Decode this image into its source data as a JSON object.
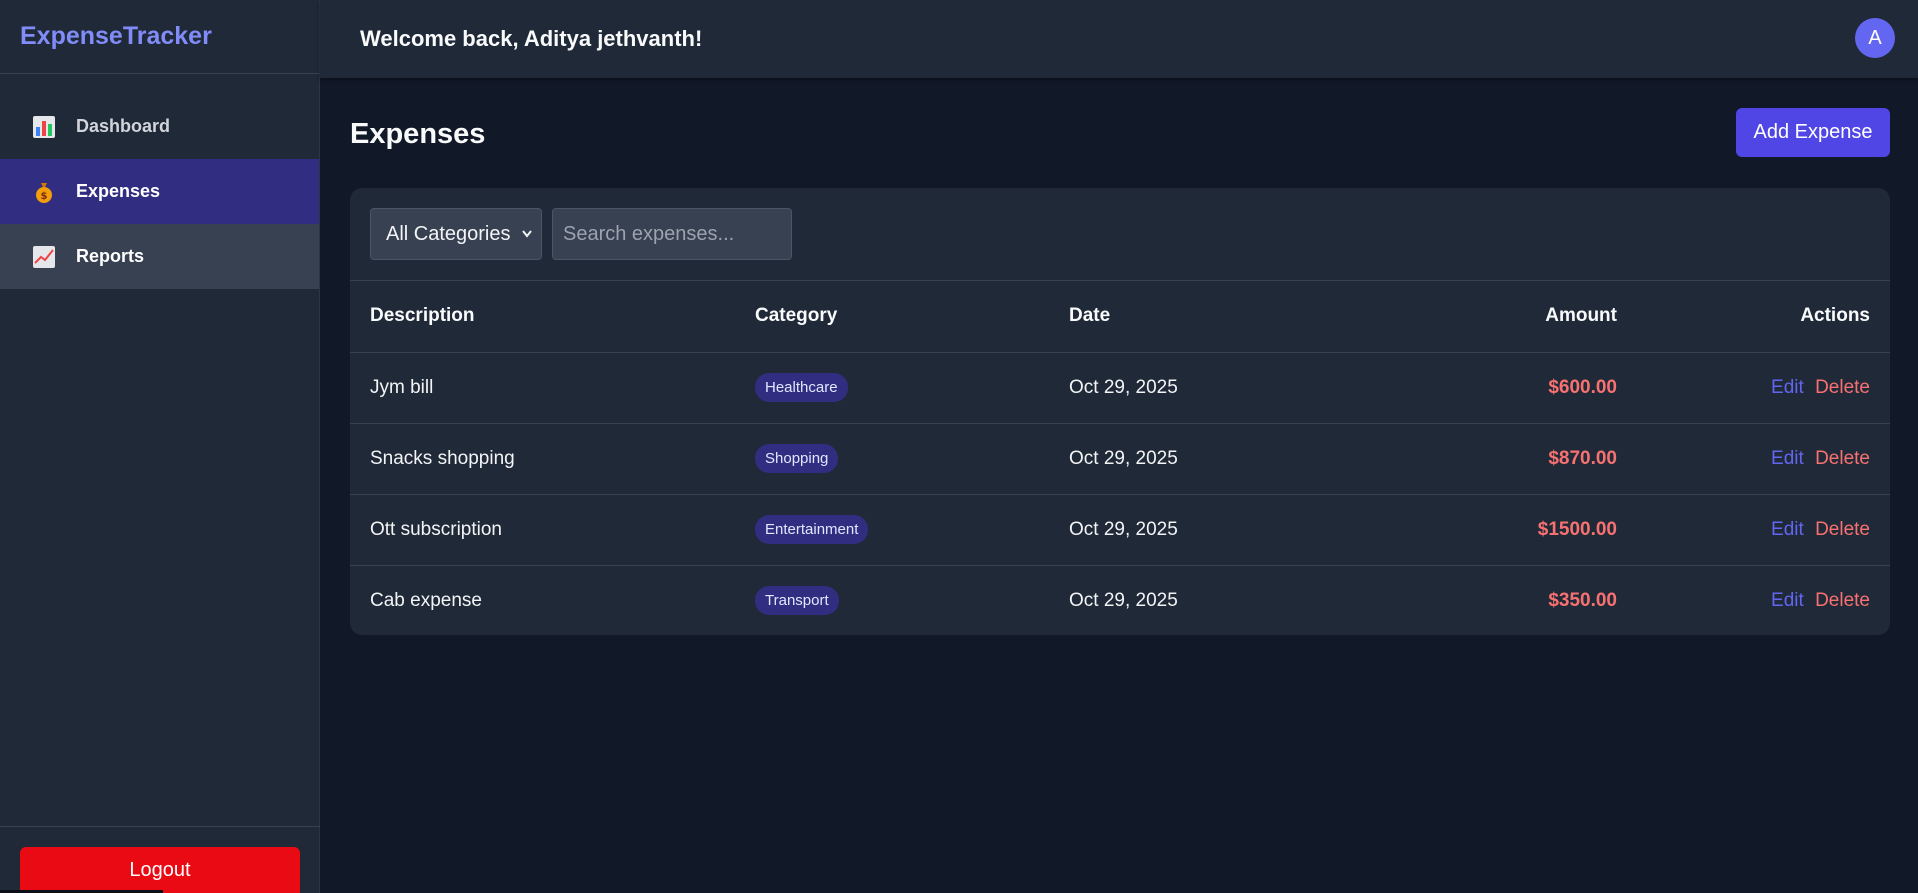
{
  "app": {
    "brand": "ExpenseTracker"
  },
  "sidebar": {
    "items": [
      {
        "label": "Dashboard",
        "icon": "bar-chart-icon"
      },
      {
        "label": "Expenses",
        "icon": "money-bag-icon"
      },
      {
        "label": "Reports",
        "icon": "trending-chart-icon"
      }
    ],
    "logout_label": "Logout"
  },
  "header": {
    "welcome": "Welcome back, Aditya jethvanth!",
    "avatar_initial": "A"
  },
  "main": {
    "title": "Expenses",
    "add_button": "Add Expense",
    "filter": {
      "category_selected": "All Categories",
      "search_placeholder": "Search expenses..."
    },
    "table": {
      "headers": {
        "description": "Description",
        "category": "Category",
        "date": "Date",
        "amount": "Amount",
        "actions": "Actions"
      },
      "rows": [
        {
          "description": "Jym bill",
          "category": "Healthcare",
          "date": "Oct 29, 2025",
          "amount": "$600.00"
        },
        {
          "description": "Snacks shopping",
          "category": "Shopping",
          "date": "Oct 29, 2025",
          "amount": "$870.00"
        },
        {
          "description": "Ott subscription",
          "category": "Entertainment",
          "date": "Oct 29, 2025",
          "amount": "$1500.00"
        },
        {
          "description": "Cab expense",
          "category": "Transport",
          "date": "Oct 29, 2025",
          "amount": "$350.00"
        }
      ],
      "edit_label": "Edit",
      "delete_label": "Delete"
    }
  },
  "colors": {
    "accent": "#4f46e5",
    "brand": "#818cf8",
    "danger": "#ea0a14",
    "amount": "#f87171"
  }
}
